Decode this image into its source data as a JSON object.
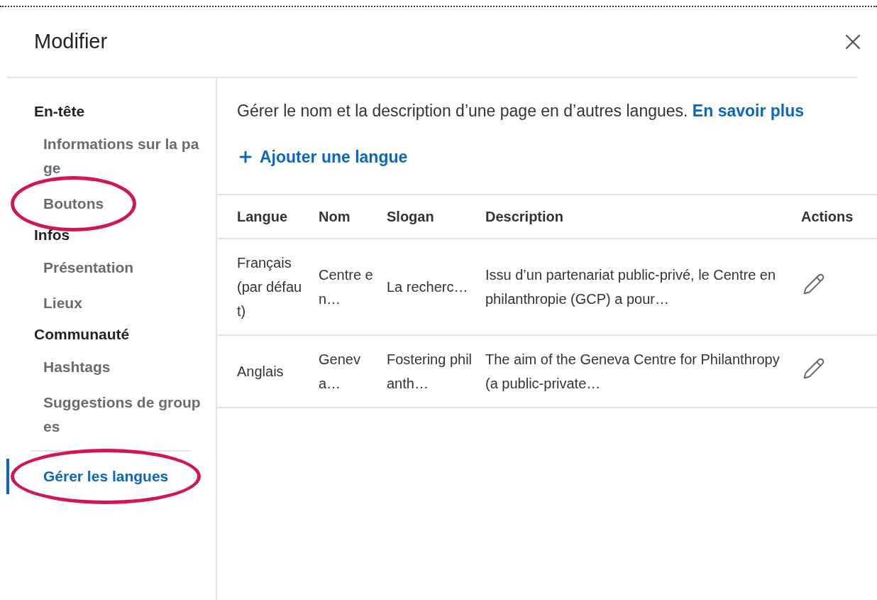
{
  "window": {
    "title": "Modifier"
  },
  "sidebar": {
    "sections": [
      {
        "title": "En-tête",
        "items": [
          {
            "label": "Informations sur la page",
            "selected": false,
            "circled": false
          },
          {
            "label": "Boutons",
            "selected": false,
            "circled": true
          }
        ]
      },
      {
        "title": "Infos",
        "items": [
          {
            "label": "Présentation",
            "selected": false,
            "circled": false
          },
          {
            "label": "Lieux",
            "selected": false,
            "circled": false
          }
        ]
      },
      {
        "title": "Communauté",
        "items": [
          {
            "label": "Hashtags",
            "selected": false,
            "circled": false
          },
          {
            "label": "Suggestions de groupes",
            "selected": false,
            "circled": false
          }
        ]
      }
    ],
    "bottom_items": [
      {
        "label": "Gérer les langues",
        "selected": true,
        "circled": true
      }
    ]
  },
  "main": {
    "intro": "Gérer le nom et la description d’une page en d’autres langues.",
    "learn_more": "En savoir plus",
    "add_button": "Ajouter une langue",
    "table": {
      "columns": [
        "Langue",
        "Nom",
        "Slogan",
        "Description",
        "Actions"
      ],
      "rows": [
        {
          "cells": [
            "Français (par défaut)",
            "Centre en…",
            "La recherc…",
            "Issu d’un partenariat public-privé, le Centre en philanthropie (GCP) a pour…"
          ]
        },
        {
          "cells": [
            "Anglais",
            "Geneva…",
            "Fostering philanth…",
            "The aim of the Geneva Centre for Philanthropy (a public-private…"
          ]
        }
      ]
    }
  }
}
